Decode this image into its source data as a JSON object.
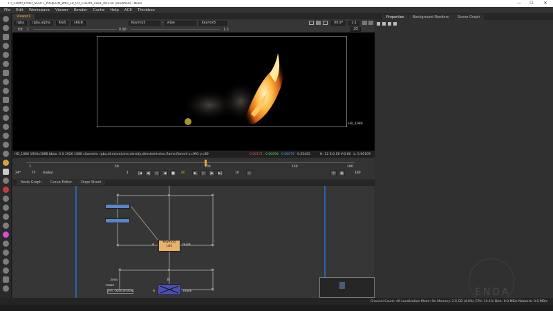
{
  "window": {
    "title": "F:\\_COMP_PYRO_SCOTT_PROJECM_WIO_10_CO_COLOR_v001_001.nk [modified] - Nuke",
    "minimize": "—",
    "maximize": "☐",
    "close": "✕"
  },
  "menu": [
    "File",
    "Edit",
    "Workspace",
    "Viewer",
    "Render",
    "Cache",
    "Help",
    "ACE",
    "Thinkbox"
  ],
  "viewer": {
    "tab": "Viewer1",
    "channels": "rgba",
    "alpha": "rgba.alpha",
    "colorspace_in": "RGB",
    "display": "sRGB",
    "input_a": "Keymix5",
    "dash": "-",
    "input_b": "wipe",
    "input_c": "Keymix5",
    "zoom": "90.9*",
    "ratio": "1:1",
    "fstop": "f/8",
    "frame_field": "1",
    "gain": "0.98",
    "gamma": "1.2",
    "view_mode": "2D",
    "format_label": "HD_1080",
    "info_prefix": "HD_1080  1920x1080  bbox: 0 0 1920 1080  channels: rgba,directvolume,density,directemission,flame,flame4  x=991 y=80",
    "px_r": "0.00171",
    "px_g": "0.00094",
    "px_b": "0.00076",
    "px_a": "0.25425",
    "hsv": "H: 12 S:0.56 V:0.00",
    "lum": "L: 0.00109"
  },
  "timeline": {
    "fps": "24*",
    "tf": "TF",
    "global": "Global",
    "ticks": [
      "1",
      "50",
      "100",
      "150",
      "190"
    ],
    "start": "1",
    "end": "190",
    "current": "80",
    "step": "10",
    "end_field": "180"
  },
  "graph_tabs": [
    "Node Graph",
    "Curve Editor",
    "Dope Sheet"
  ],
  "nodes": {
    "keymix": "Keymix5\n(all)",
    "optical_glow": "bm_OpticalGlow",
    "mask_label": "mask",
    "area_label": "area",
    "a_label": "A",
    "b_label": "B",
    "mask_label2": "mask",
    "a_label2": "A"
  },
  "props_tabs": [
    "Properties",
    "Background Renders",
    "Scene Graph"
  ],
  "status": "Channel Count: 49  Localization Mode: On  Memory: 2.6 GB (4.0%)  CPU: 14.1%  Disk: 0.0 MB/s  Network: 0.0 MB/s",
  "watermark": "ENDA",
  "colors": {
    "accent": "#e8a53a",
    "node_keymix": "#e8b368",
    "node_blue": "#5a86c8",
    "node_glow": "#4b4fb4",
    "pipe_blue": "#2f63ad"
  }
}
